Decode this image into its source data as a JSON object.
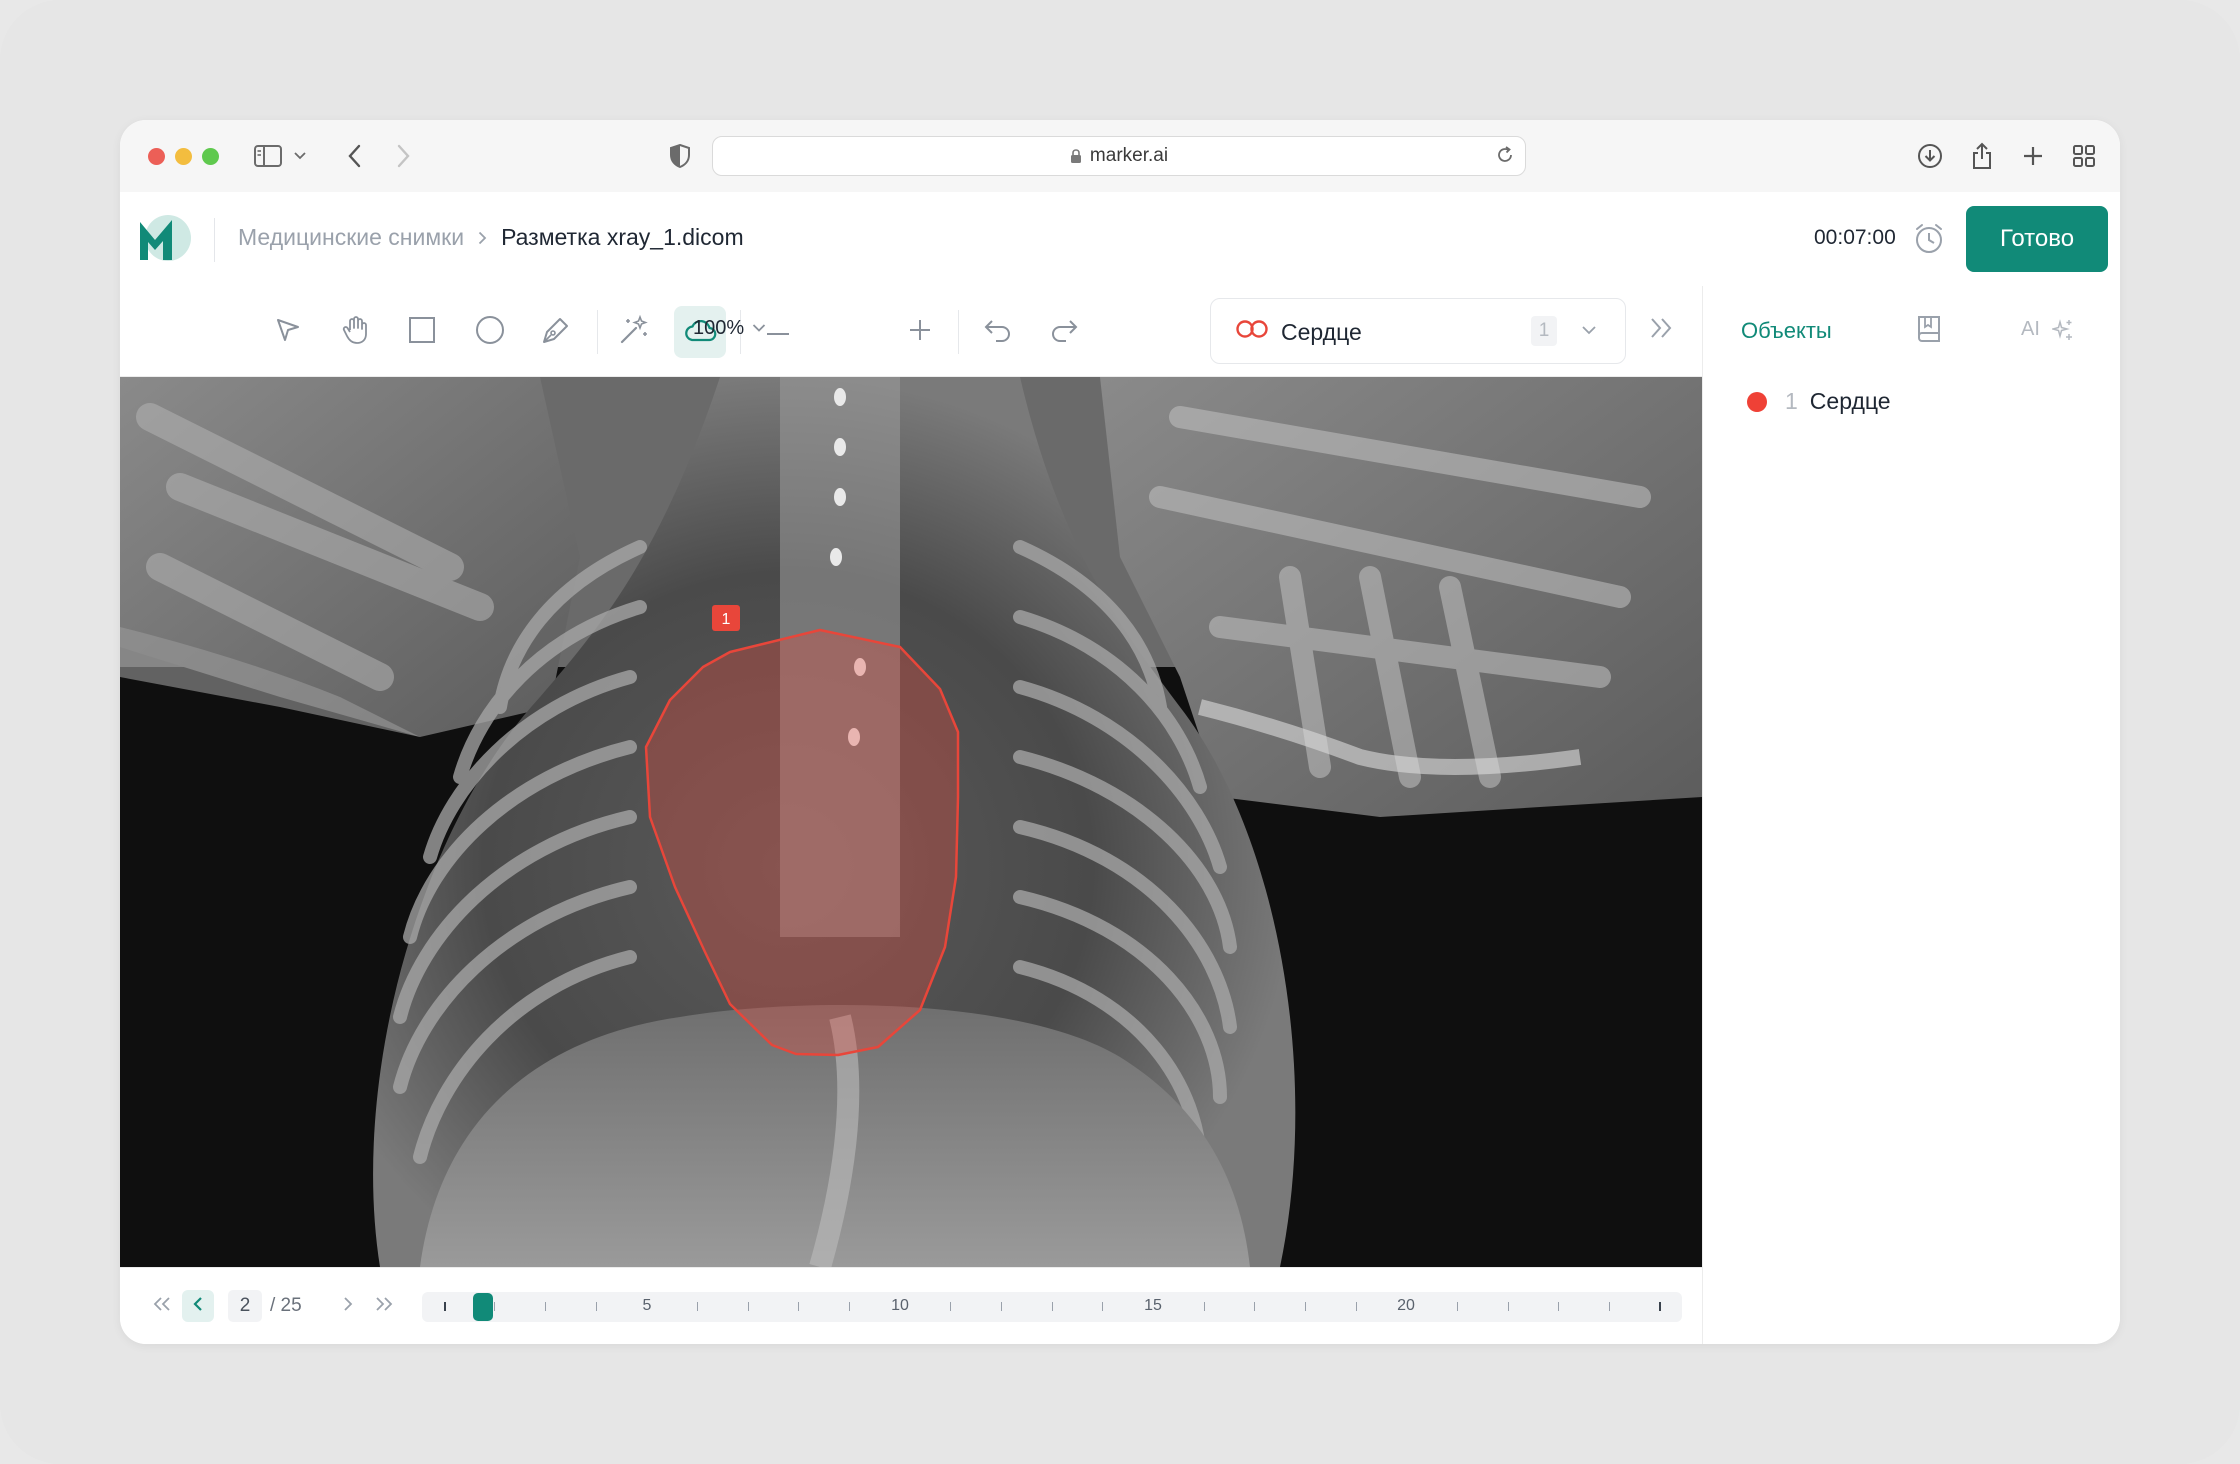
{
  "browser": {
    "url": "marker.ai"
  },
  "header": {
    "breadcrumb_parent": "Медицинские снимки",
    "breadcrumb_current": "Разметка xray_1.dicom",
    "timer": "00:07:00",
    "done_label": "Готово"
  },
  "toolbar": {
    "zoom": "100%",
    "class_label": "Сердце",
    "class_count": "1"
  },
  "annotation": {
    "badge": "1",
    "color": "#e8463a"
  },
  "navigation": {
    "current_page": "2",
    "total_pages": "/ 25",
    "timeline_labels": [
      "5",
      "10",
      "15",
      "20"
    ]
  },
  "panel": {
    "tab_objects": "Объекты",
    "tab_ai": "AI",
    "objects": [
      {
        "index": "1",
        "label": "Сердце",
        "color": "#ef4136"
      }
    ]
  },
  "colors": {
    "accent": "#118a78",
    "annotation": "#e8463a"
  }
}
